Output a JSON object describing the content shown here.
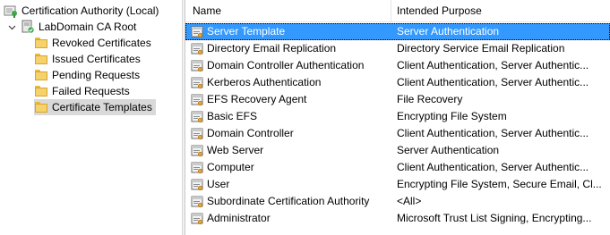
{
  "tree": {
    "root": {
      "label": "Certification Authority (Local)"
    },
    "ca": {
      "label": "LabDomain CA Root",
      "expander": "chevron-down-icon"
    },
    "folders": [
      {
        "label": "Revoked Certificates",
        "selected": false
      },
      {
        "label": "Issued Certificates",
        "selected": false
      },
      {
        "label": "Pending Requests",
        "selected": false
      },
      {
        "label": "Failed Requests",
        "selected": false
      },
      {
        "label": "Certificate Templates",
        "selected": true
      }
    ]
  },
  "list": {
    "columns": {
      "name": "Name",
      "purpose": "Intended Purpose"
    },
    "rows": [
      {
        "name": "Server Template",
        "purpose": "Server Authentication",
        "selected": true
      },
      {
        "name": "Directory Email Replication",
        "purpose": "Directory Service Email Replication",
        "selected": false
      },
      {
        "name": "Domain Controller Authentication",
        "purpose": "Client Authentication, Server Authentic...",
        "selected": false
      },
      {
        "name": "Kerberos Authentication",
        "purpose": "Client Authentication, Server Authentic...",
        "selected": false
      },
      {
        "name": "EFS Recovery Agent",
        "purpose": "File Recovery",
        "selected": false
      },
      {
        "name": "Basic EFS",
        "purpose": "Encrypting File System",
        "selected": false
      },
      {
        "name": "Domain Controller",
        "purpose": "Client Authentication, Server Authentic...",
        "selected": false
      },
      {
        "name": "Web Server",
        "purpose": "Server Authentication",
        "selected": false
      },
      {
        "name": "Computer",
        "purpose": "Client Authentication, Server Authentic...",
        "selected": false
      },
      {
        "name": "User",
        "purpose": "Encrypting File System, Secure Email, Cl...",
        "selected": false
      },
      {
        "name": "Subordinate Certification Authority",
        "purpose": "<All>",
        "selected": false
      },
      {
        "name": "Administrator",
        "purpose": "Microsoft Trust List Signing, Encrypting...",
        "selected": false
      }
    ]
  },
  "colors": {
    "selection_blue": "#3399ff",
    "tree_selection_gray": "#d9d9d9",
    "folder_yellow": "#f6d36a",
    "ca_green": "#3aa845"
  }
}
